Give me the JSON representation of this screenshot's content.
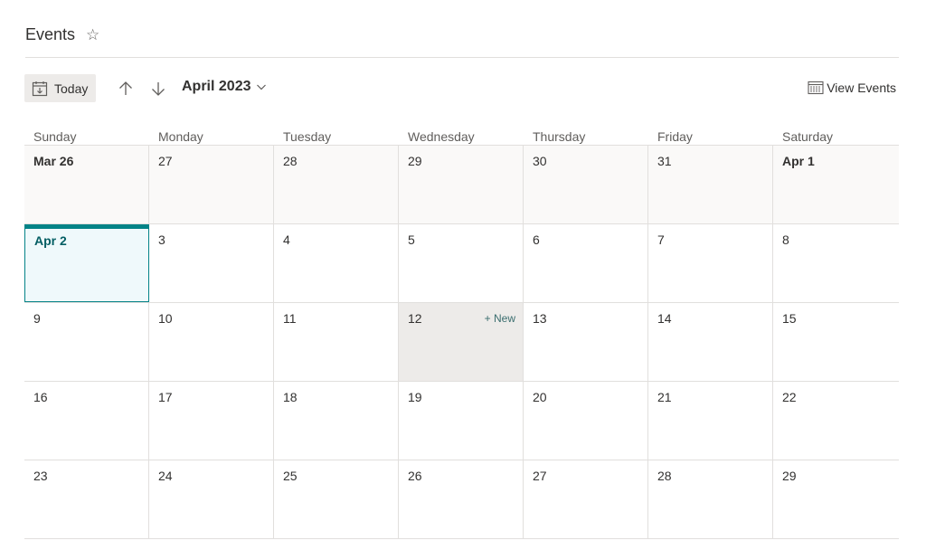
{
  "header": {
    "title": "Events"
  },
  "toolbar": {
    "today_label": "Today",
    "month_label": "April 2023",
    "view_events_label": "View Events"
  },
  "calendar": {
    "weekdays": [
      "Sunday",
      "Monday",
      "Tuesday",
      "Wednesday",
      "Thursday",
      "Friday",
      "Saturday"
    ],
    "weeks": [
      {
        "days": [
          {
            "label": "Mar 26",
            "state": "other",
            "bold": true
          },
          {
            "label": "27",
            "state": "other"
          },
          {
            "label": "28",
            "state": "other"
          },
          {
            "label": "29",
            "state": "other"
          },
          {
            "label": "30",
            "state": "other"
          },
          {
            "label": "31",
            "state": "other"
          },
          {
            "label": "Apr 1",
            "state": "other",
            "bold": true
          }
        ]
      },
      {
        "days": [
          {
            "label": "Apr 2",
            "state": "today",
            "bold": true
          },
          {
            "label": "3"
          },
          {
            "label": "4"
          },
          {
            "label": "5"
          },
          {
            "label": "6"
          },
          {
            "label": "7"
          },
          {
            "label": "8"
          }
        ]
      },
      {
        "days": [
          {
            "label": "9"
          },
          {
            "label": "10"
          },
          {
            "label": "11"
          },
          {
            "label": "12",
            "state": "hover",
            "new_label": "+ New"
          },
          {
            "label": "13"
          },
          {
            "label": "14"
          },
          {
            "label": "15"
          }
        ]
      },
      {
        "days": [
          {
            "label": "16"
          },
          {
            "label": "17"
          },
          {
            "label": "18"
          },
          {
            "label": "19"
          },
          {
            "label": "20"
          },
          {
            "label": "21"
          },
          {
            "label": "22"
          }
        ]
      },
      {
        "days": [
          {
            "label": "23"
          },
          {
            "label": "24"
          },
          {
            "label": "25"
          },
          {
            "label": "26"
          },
          {
            "label": "27"
          },
          {
            "label": "28"
          },
          {
            "label": "29"
          }
        ]
      }
    ]
  },
  "colors": {
    "accent": "#038387",
    "today_bg": "#eff9fb",
    "other_month_bg": "#faf9f8",
    "hover_bg": "#edebe9"
  },
  "icons": [
    "star-icon",
    "calendar-today-icon",
    "arrow-up-icon",
    "arrow-down-icon",
    "chevron-down-icon",
    "calendar-grid-icon"
  ]
}
